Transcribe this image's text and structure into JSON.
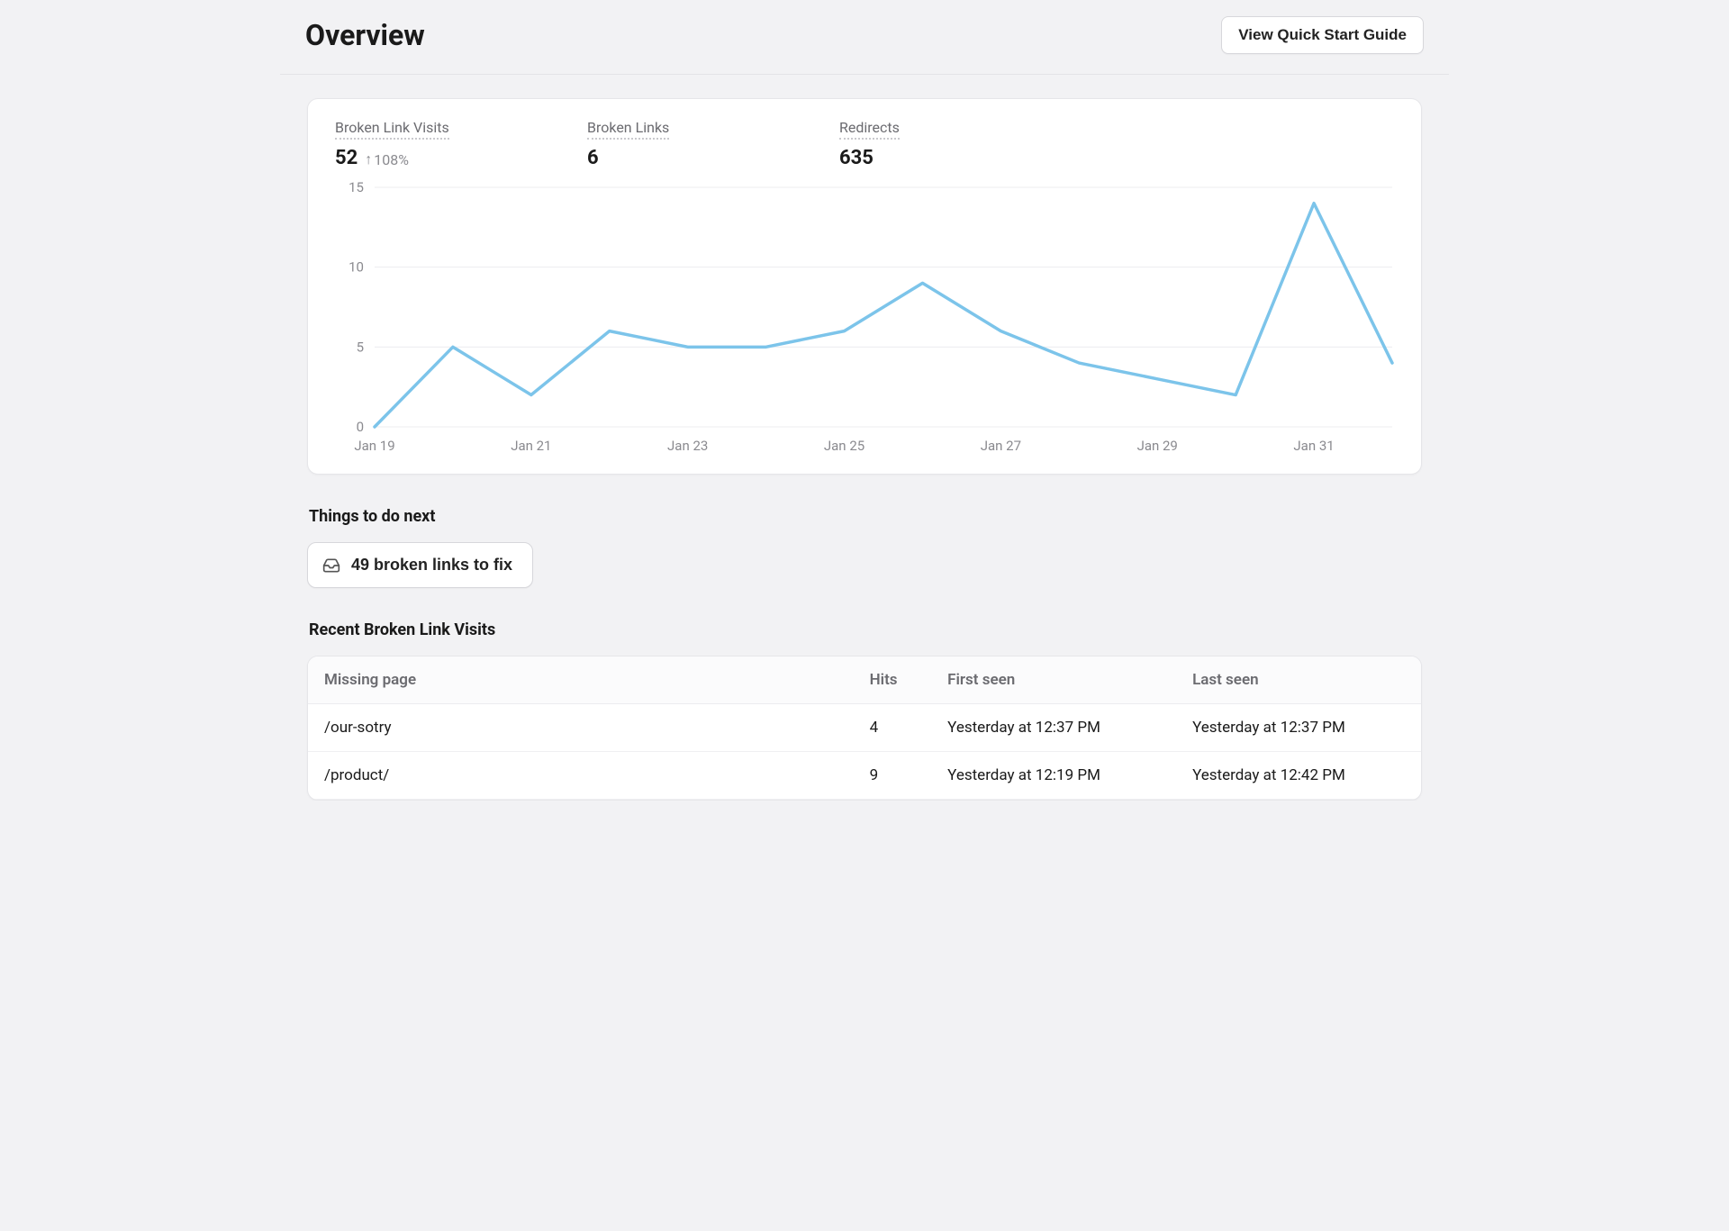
{
  "header": {
    "title": "Overview",
    "guide_button": "View Quick Start Guide"
  },
  "stats": [
    {
      "label": "Broken Link Visits",
      "value": "52",
      "delta": "108%",
      "delta_direction": "up"
    },
    {
      "label": "Broken Links",
      "value": "6",
      "delta": "",
      "delta_direction": ""
    },
    {
      "label": "Redirects",
      "value": "635",
      "delta": "",
      "delta_direction": ""
    }
  ],
  "chart_data": {
    "type": "line",
    "title": "",
    "xlabel": "",
    "ylabel": "",
    "ylim": [
      0,
      15
    ],
    "y_ticks": [
      0,
      5,
      10,
      15
    ],
    "categories": [
      "Jan 19",
      "Jan 20",
      "Jan 21",
      "Jan 22",
      "Jan 23",
      "Jan 24",
      "Jan 25",
      "Jan 26",
      "Jan 27",
      "Jan 28",
      "Jan 29",
      "Jan 30",
      "Jan 31",
      "Feb 1"
    ],
    "x_tick_labels": [
      "Jan 19",
      "Jan 21",
      "Jan 23",
      "Jan 25",
      "Jan 27",
      "Jan 29",
      "Jan 31"
    ],
    "values": [
      0,
      5,
      2,
      6,
      5,
      5,
      6,
      9,
      6,
      4,
      3,
      2,
      14,
      4
    ],
    "line_color": "#7cc4ea"
  },
  "todo": {
    "section_title": "Things to do next",
    "items": [
      {
        "icon": "inbox-icon",
        "label": "49 broken links to fix"
      }
    ]
  },
  "recent": {
    "section_title": "Recent Broken Link Visits",
    "columns": [
      "Missing page",
      "Hits",
      "First seen",
      "Last seen"
    ],
    "rows": [
      {
        "missing_page": "/our-sotry",
        "hits": "4",
        "first_seen": "Yesterday at 12:37 PM",
        "last_seen": "Yesterday at 12:37 PM"
      },
      {
        "missing_page": "/product/",
        "hits": "9",
        "first_seen": "Yesterday at 12:19 PM",
        "last_seen": "Yesterday at 12:42 PM"
      }
    ]
  }
}
